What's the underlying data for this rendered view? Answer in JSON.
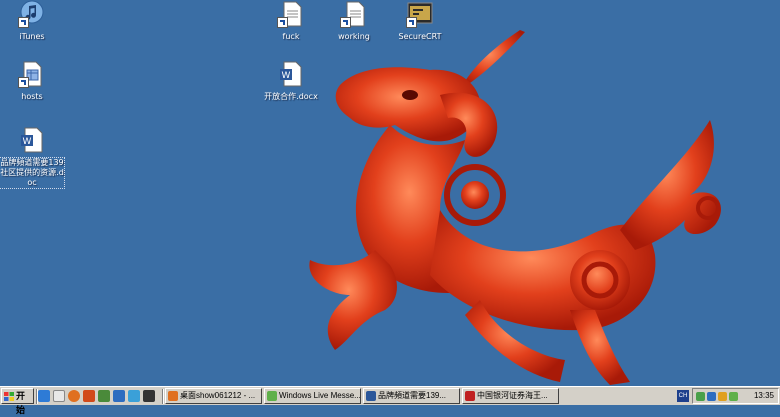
{
  "desktop": {
    "icons": [
      {
        "label": "iTunes"
      },
      {
        "label": "hosts"
      },
      {
        "label": "品牌頻道需要139社区提供的资源.doc"
      },
      {
        "label": "fuck"
      },
      {
        "label": "working"
      },
      {
        "label": "SecureCRT"
      },
      {
        "label": "开放合作.docx"
      }
    ],
    "background_color": "#3a6ea5",
    "wallpaper_icon": "red-qilin-dragon-icon"
  },
  "taskbar": {
    "start_label": "开始",
    "tasks": [
      {
        "label": "桌面show061212 - ...",
        "icon": "browser-icon"
      },
      {
        "label": "Windows Live Messe...",
        "icon": "messenger-icon"
      },
      {
        "label": "品牌頻道需要139...",
        "icon": "word-icon"
      },
      {
        "label": "中国银河证券海王...",
        "icon": "app-icon"
      }
    ],
    "clock": "13:35",
    "language_indicator": "CH"
  }
}
